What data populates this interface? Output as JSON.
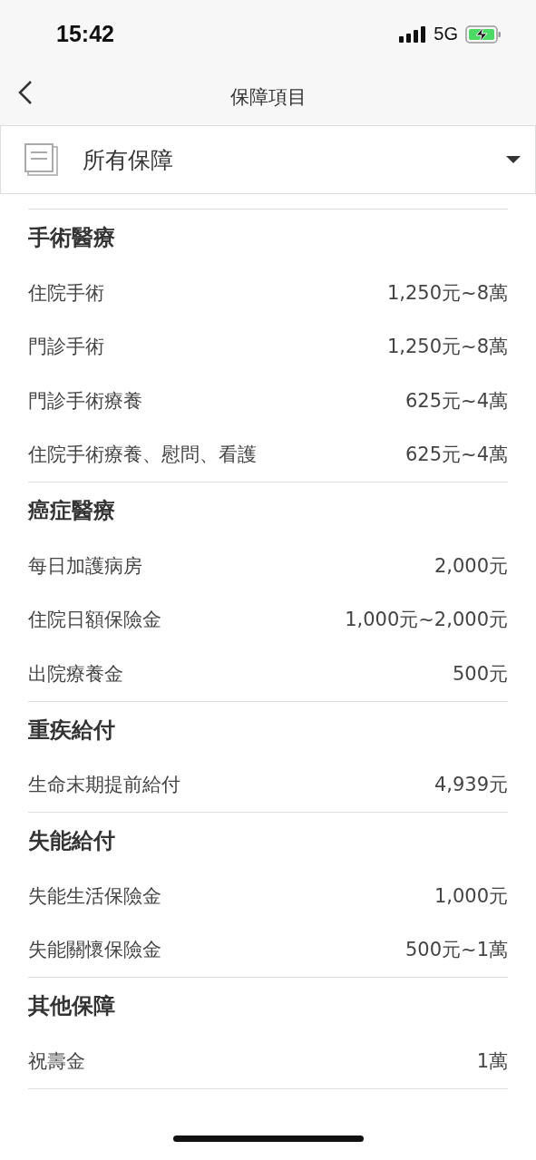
{
  "status_bar": {
    "time": "15:42",
    "network": "5G"
  },
  "nav": {
    "title": "保障項目"
  },
  "filter": {
    "label": "所有保障"
  },
  "sections": [
    {
      "title": "手術醫療",
      "rows": [
        {
          "name": "住院手術",
          "amount": "1,250元~8萬"
        },
        {
          "name": "門診手術",
          "amount": "1,250元~8萬"
        },
        {
          "name": "門診手術療養",
          "amount": "625元~4萬"
        },
        {
          "name": "住院手術療養、慰問、看護",
          "amount": "625元~4萬"
        }
      ]
    },
    {
      "title": "癌症醫療",
      "rows": [
        {
          "name": "每日加護病房",
          "amount": "2,000元"
        },
        {
          "name": "住院日額保險金",
          "amount": "1,000元~2,000元"
        },
        {
          "name": "出院療養金",
          "amount": "500元"
        }
      ]
    },
    {
      "title": "重疾給付",
      "rows": [
        {
          "name": "生命末期提前給付",
          "amount": "4,939元"
        }
      ]
    },
    {
      "title": "失能給付",
      "rows": [
        {
          "name": "失能生活保險金",
          "amount": "1,000元"
        },
        {
          "name": "失能關懷保險金",
          "amount": "500元~1萬"
        }
      ]
    },
    {
      "title": "其他保障",
      "rows": [
        {
          "name": "祝壽金",
          "amount": "1萬"
        }
      ]
    }
  ]
}
